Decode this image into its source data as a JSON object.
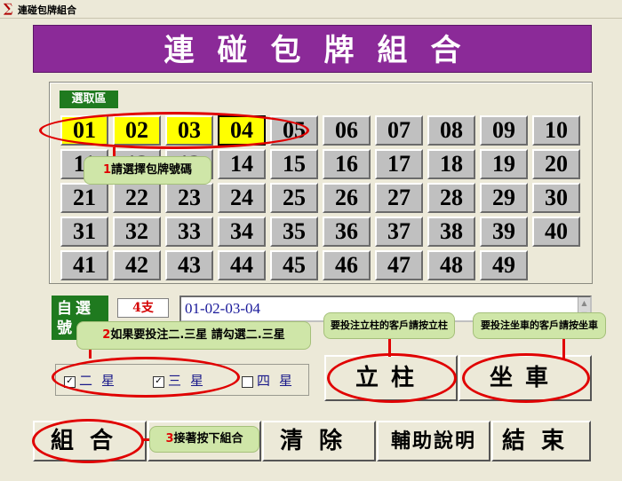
{
  "window": {
    "title": "連碰包牌組合"
  },
  "banner": {
    "title": "連碰包牌組合"
  },
  "selection_area": {
    "label": "選取區"
  },
  "numbers": [
    "01",
    "02",
    "03",
    "04",
    "05",
    "06",
    "07",
    "08",
    "09",
    "10",
    "11",
    "12",
    "13",
    "14",
    "15",
    "16",
    "17",
    "18",
    "19",
    "20",
    "21",
    "22",
    "23",
    "24",
    "25",
    "26",
    "27",
    "28",
    "29",
    "30",
    "31",
    "32",
    "33",
    "34",
    "35",
    "36",
    "37",
    "38",
    "39",
    "40",
    "41",
    "42",
    "43",
    "44",
    "45",
    "46",
    "47",
    "48",
    "49"
  ],
  "selected_numbers": [
    "01",
    "02",
    "03",
    "04"
  ],
  "self_select": {
    "label": "自選號",
    "count": "4支",
    "value": "01-02-03-04"
  },
  "stars": [
    {
      "label": "二星",
      "checked": true,
      "mark": "✓"
    },
    {
      "label": "三星",
      "checked": true,
      "mark": "✓"
    },
    {
      "label": "四星",
      "checked": false,
      "mark": ""
    }
  ],
  "buttons": {
    "lizhu": "立柱",
    "zuoche": "坐車",
    "combine": "組合",
    "clear": "清除",
    "help": "輔助說明",
    "exit": "結束"
  },
  "annotations": {
    "a1_num": "1",
    "a1_text": "請選擇包牌號碼",
    "a2_num": "2",
    "a2_text": "如果要投注二.三星 請勾選二.三星",
    "a3_num": "3",
    "a3_text": "接著按下組合",
    "lizhu_tip": "要投注立柱的客戶請按立柱",
    "zuoche_tip": "要投注坐車的客戶請按坐車"
  },
  "colors": {
    "banner": "#8b2a98",
    "selected": "#ffff00",
    "label_green": "#1f7a1f",
    "annotation": "#cfe6a8",
    "ring": "#e00000"
  }
}
